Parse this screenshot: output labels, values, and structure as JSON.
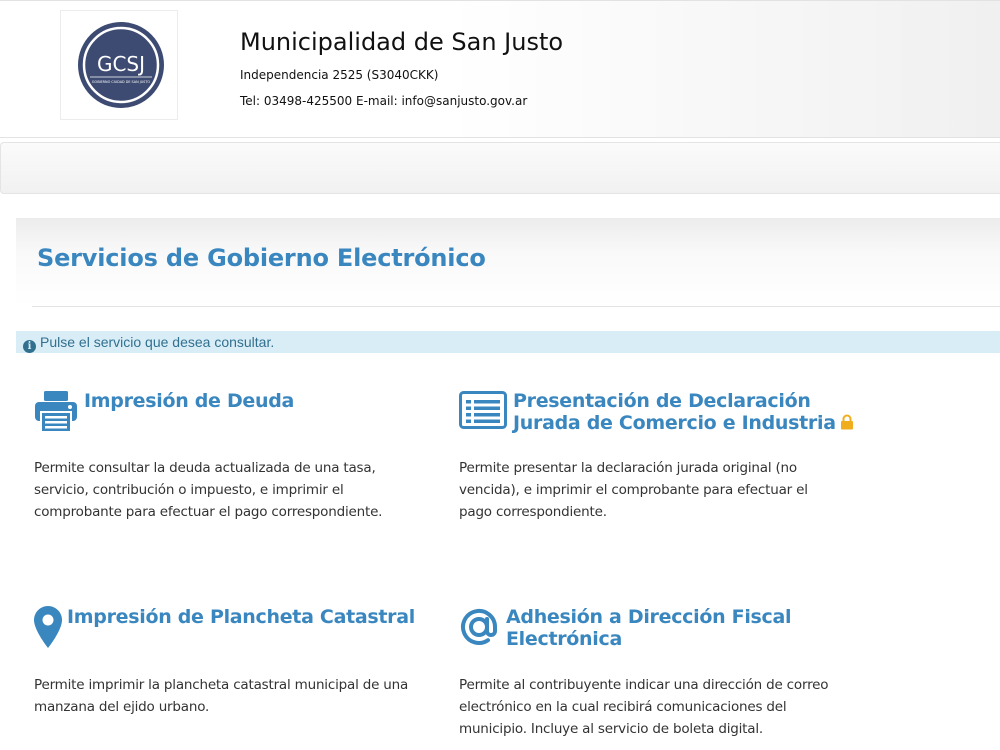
{
  "header": {
    "logo_text": "GCSJ",
    "logo_subtext": "GOBIERNO CIUDAD DE SAN JUSTO",
    "name": "Municipalidad de San Justo",
    "address": "Independencia 2525 (S3040CKK)",
    "contact": "Tel: 03498-425500 E-mail: info@sanjusto.gov.ar"
  },
  "page": {
    "title": "Servicios de Gobierno Electrónico",
    "info_icon": "info-circle-icon",
    "info_text": "Pulse el servicio que desea consultar."
  },
  "services": [
    {
      "icon": "printer-icon",
      "title_lines": [
        "Impresión de Deuda"
      ],
      "desc_lines": [
        "Permite consultar la deuda actualizada de una tasa,",
        "servicio, contribución o impuesto, e imprimir el",
        "comprobante para efectuar el pago correspondiente."
      ]
    },
    {
      "icon": "list-document-icon",
      "title_lines": [
        "Presentación de Declaración",
        "Jurada de Comercio e Industria"
      ],
      "badge_icon": "lock-icon",
      "desc_lines": [
        "Permite presentar la declaración jurada original (no",
        "vencida), e imprimir el comprobante para efectuar el",
        "pago correspondiente."
      ]
    },
    {
      "icon": "map-marker-icon",
      "title_lines": [
        "Impresión de Plancheta Catastral"
      ],
      "desc_lines": [
        "Permite imprimir la plancheta catastral municipal de una",
        "manzana del ejido urbano."
      ]
    },
    {
      "icon": "at-sign-icon",
      "title_lines": [
        "Adhesión a Dirección Fiscal",
        "Electrónica"
      ],
      "desc_lines": [
        "Permite al contribuyente indicar una dirección de correo",
        "electrónico en la cual recibirá comunicaciones del",
        "municipio. Incluye al servicio de boleta digital."
      ]
    }
  ],
  "colors": {
    "accent": "#3a87c0",
    "logo_navy": "#3d4a72",
    "info_bg": "#d9edf7",
    "info_text": "#31708f",
    "lock": "#f0ad1e"
  }
}
